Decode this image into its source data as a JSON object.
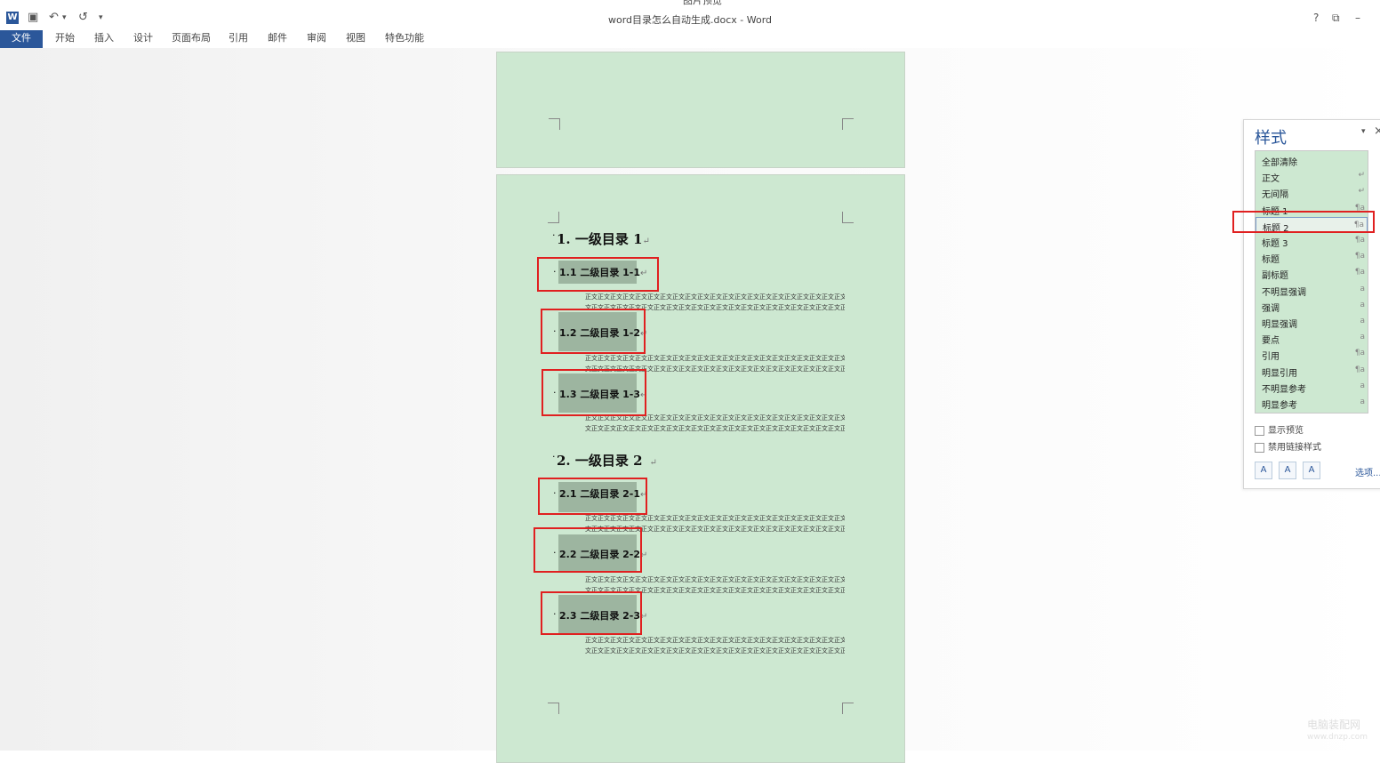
{
  "window": {
    "caption": "图片预览",
    "title": "word目录怎么自动生成.docx - Word",
    "quick_access": {
      "app_icon": "W",
      "save_icon": "▣",
      "undo_icon": "↶",
      "undo_dropdown": "▾",
      "redo_icon": "↺",
      "customize_icon": "▾"
    },
    "controls": {
      "help": "?",
      "ribbon_display": "⧉",
      "minimize": "–"
    }
  },
  "ribbon": {
    "tabs": [
      "文件",
      "开始",
      "插入",
      "设计",
      "页面布局",
      "引用",
      "邮件",
      "审阅",
      "视图",
      "特色功能"
    ],
    "active_tab": "文件",
    "accent_color": "#2b579a"
  },
  "document": {
    "page_color": "#cde8d1",
    "heading1": [
      "1. 一级目录 1",
      "2. 一级目录 2"
    ],
    "heading2": [
      "1.1 二级目录 1-1",
      "1.2 二级目录 1-2",
      "1.3 二级目录 1-3",
      "2.1 二级目录 2-1",
      "2.2 二级目录 2-2",
      "2.3 二级目录 2-3"
    ],
    "body_text": {
      "line1": "正文正文正文正文正文正文正文正文正文正文正文正文正文正文正文正文正文正文正文正文正文正文正文",
      "line2": "文正文正文正文正文正文正文正文正文正文正文正文正文正文正文正文正文正文正文正文正文正文。"
    },
    "para_mark": "↵",
    "bullet": "·"
  },
  "styles_pane": {
    "title": "样式",
    "menu_icon": "▾",
    "close_icon": "×",
    "items": [
      {
        "name": "全部清除",
        "mark": ""
      },
      {
        "name": "正文",
        "mark": "↵"
      },
      {
        "name": "无间隔",
        "mark": "↵"
      },
      {
        "name": "标题 1",
        "mark": "¶a"
      },
      {
        "name": "标题 2",
        "mark": "¶a"
      },
      {
        "name": "标题 3",
        "mark": "¶a"
      },
      {
        "name": "标题",
        "mark": "¶a"
      },
      {
        "name": "副标题",
        "mark": "¶a"
      },
      {
        "name": "不明显强调",
        "mark": "a"
      },
      {
        "name": "强调",
        "mark": "a"
      },
      {
        "name": "明显强调",
        "mark": "a"
      },
      {
        "name": "要点",
        "mark": "a"
      },
      {
        "name": "引用",
        "mark": "¶a"
      },
      {
        "name": "明显引用",
        "mark": "¶a"
      },
      {
        "name": "不明显参考",
        "mark": "a"
      },
      {
        "name": "明显参考",
        "mark": "a"
      }
    ],
    "selected": "标题 2",
    "show_preview": "显示预览",
    "disable_linked": "禁用链接样式",
    "buttons": {
      "new_style": "A",
      "style_inspector": "A",
      "manage_styles": "A"
    },
    "options_link": "选项..."
  },
  "watermark": {
    "line1": "电脑装配网",
    "line2": "www.dnzp.com"
  },
  "highlight_color": "#e02020"
}
